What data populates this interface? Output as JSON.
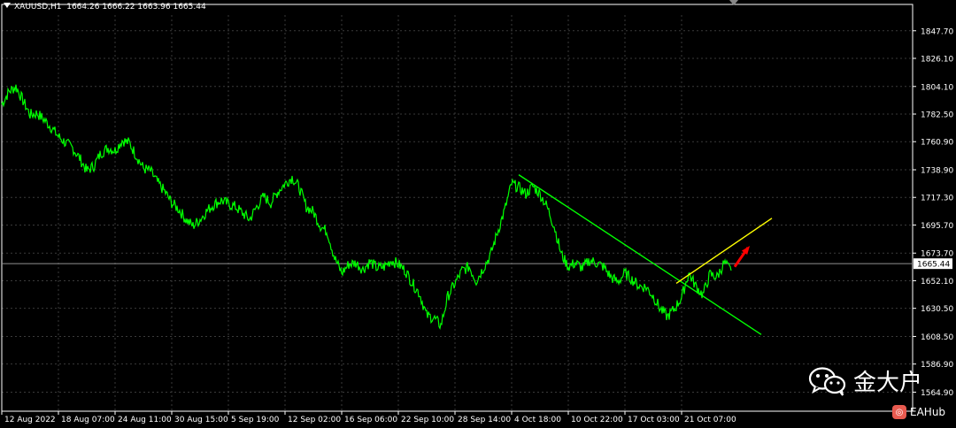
{
  "header": {
    "symbol": "XAUUSD,H1",
    "ohlc": "1664.26 1666.22 1663.96 1665.44"
  },
  "watermark": {
    "text": "金大户",
    "icon": "wechat-icon"
  },
  "brand": {
    "text": "EAHub",
    "icon": "eahub-logo-icon"
  },
  "colors": {
    "background": "#000000",
    "price_line": "#00ff00",
    "axis": "#ffffff",
    "grid": "#3a3a3a",
    "down_trendline": "#00ff00",
    "up_trendline": "#ffff00",
    "arrow": "#ff0000",
    "bid_line": "#909090"
  },
  "chart_data": {
    "type": "line",
    "grid": true,
    "y_axis_position": "right",
    "ylim": [
      1550,
      1860
    ],
    "yticks": [
      "1847.70",
      "1826.10",
      "1804.10",
      "1782.50",
      "1760.90",
      "1738.90",
      "1717.30",
      "1695.70",
      "1673.70",
      "1652.10",
      "1630.50",
      "1608.50",
      "1586.90",
      "1564.90"
    ],
    "ytick_values": [
      1847.7,
      1826.1,
      1804.1,
      1782.5,
      1760.9,
      1738.9,
      1717.3,
      1695.7,
      1673.7,
      1652.1,
      1630.5,
      1608.5,
      1586.9,
      1564.9
    ],
    "current_price": {
      "label": "1665.44",
      "value": 1665.44
    },
    "xticks": [
      "12 Aug 2022",
      "18 Aug 07:00",
      "24 Aug 11:00",
      "30 Aug 15:00",
      "5 Sep 19:00",
      "12 Sep 02:00",
      "16 Sep 06:00",
      "22 Sep 10:00",
      "28 Sep 14:00",
      "4 Oct 18:00",
      "10 Oct 22:00",
      "17 Oct 03:00",
      "21 Oct 07:00"
    ],
    "xtick_index": [
      0,
      64,
      128,
      192,
      256,
      320,
      384,
      448,
      512,
      576,
      640,
      704,
      768
    ],
    "index_range": [
      0,
      1029
    ],
    "series": [
      {
        "x": [
          0,
          8,
          16,
          24,
          32,
          40,
          48,
          56,
          64,
          72,
          80,
          88,
          96,
          104,
          112,
          120,
          128,
          136,
          144,
          152,
          160,
          168,
          176,
          184,
          192,
          200,
          208,
          216,
          224,
          232,
          240,
          248,
          256,
          264,
          272,
          280,
          288,
          296,
          304,
          312,
          320,
          328,
          336,
          344,
          352,
          360,
          368,
          376,
          384,
          392,
          400,
          408,
          416,
          424,
          432,
          440,
          448,
          456,
          464,
          472,
          480,
          488,
          496,
          504,
          512,
          520,
          528,
          536,
          544,
          552,
          560,
          568,
          576,
          584,
          592,
          600,
          608,
          616,
          624,
          632,
          640,
          648,
          656,
          664,
          672,
          680,
          688,
          696,
          704,
          712,
          720,
          728,
          736,
          744,
          752,
          760,
          768,
          776,
          784,
          792,
          800,
          808,
          816,
          824
        ],
        "values": [
          1790,
          1800,
          1804,
          1793,
          1782,
          1783,
          1778,
          1772,
          1765,
          1760,
          1756,
          1748,
          1738,
          1742,
          1752,
          1756,
          1754,
          1762,
          1760,
          1750,
          1740,
          1738,
          1729,
          1722,
          1713,
          1708,
          1700,
          1695,
          1700,
          1707,
          1712,
          1715,
          1712,
          1710,
          1705,
          1700,
          1710,
          1718,
          1713,
          1722,
          1728,
          1733,
          1725,
          1710,
          1706,
          1695,
          1690,
          1670,
          1658,
          1665,
          1666,
          1661,
          1667,
          1662,
          1663,
          1668,
          1665,
          1660,
          1650,
          1642,
          1625,
          1623,
          1617,
          1640,
          1650,
          1660,
          1663,
          1652,
          1662,
          1672,
          1690,
          1707,
          1728,
          1725,
          1720,
          1726,
          1720,
          1710,
          1695,
          1673,
          1663,
          1666,
          1662,
          1668,
          1666,
          1663,
          1655,
          1651,
          1658,
          1653,
          1648,
          1647,
          1640,
          1630,
          1624,
          1630,
          1639,
          1658,
          1648,
          1641,
          1657,
          1655,
          1666,
          1660
        ]
      }
    ],
    "annotations": [
      {
        "type": "trendline",
        "color": "#00ff00",
        "from": [
          584,
          1735
        ],
        "to": [
          858,
          1610
        ]
      },
      {
        "type": "trendline",
        "color": "#ffff00",
        "from": [
          762,
          1650
        ],
        "to": [
          870,
          1701
        ]
      },
      {
        "type": "arrow",
        "color": "#ff0000",
        "from": [
          828,
          1663
        ],
        "to": [
          843,
          1678
        ]
      }
    ]
  }
}
